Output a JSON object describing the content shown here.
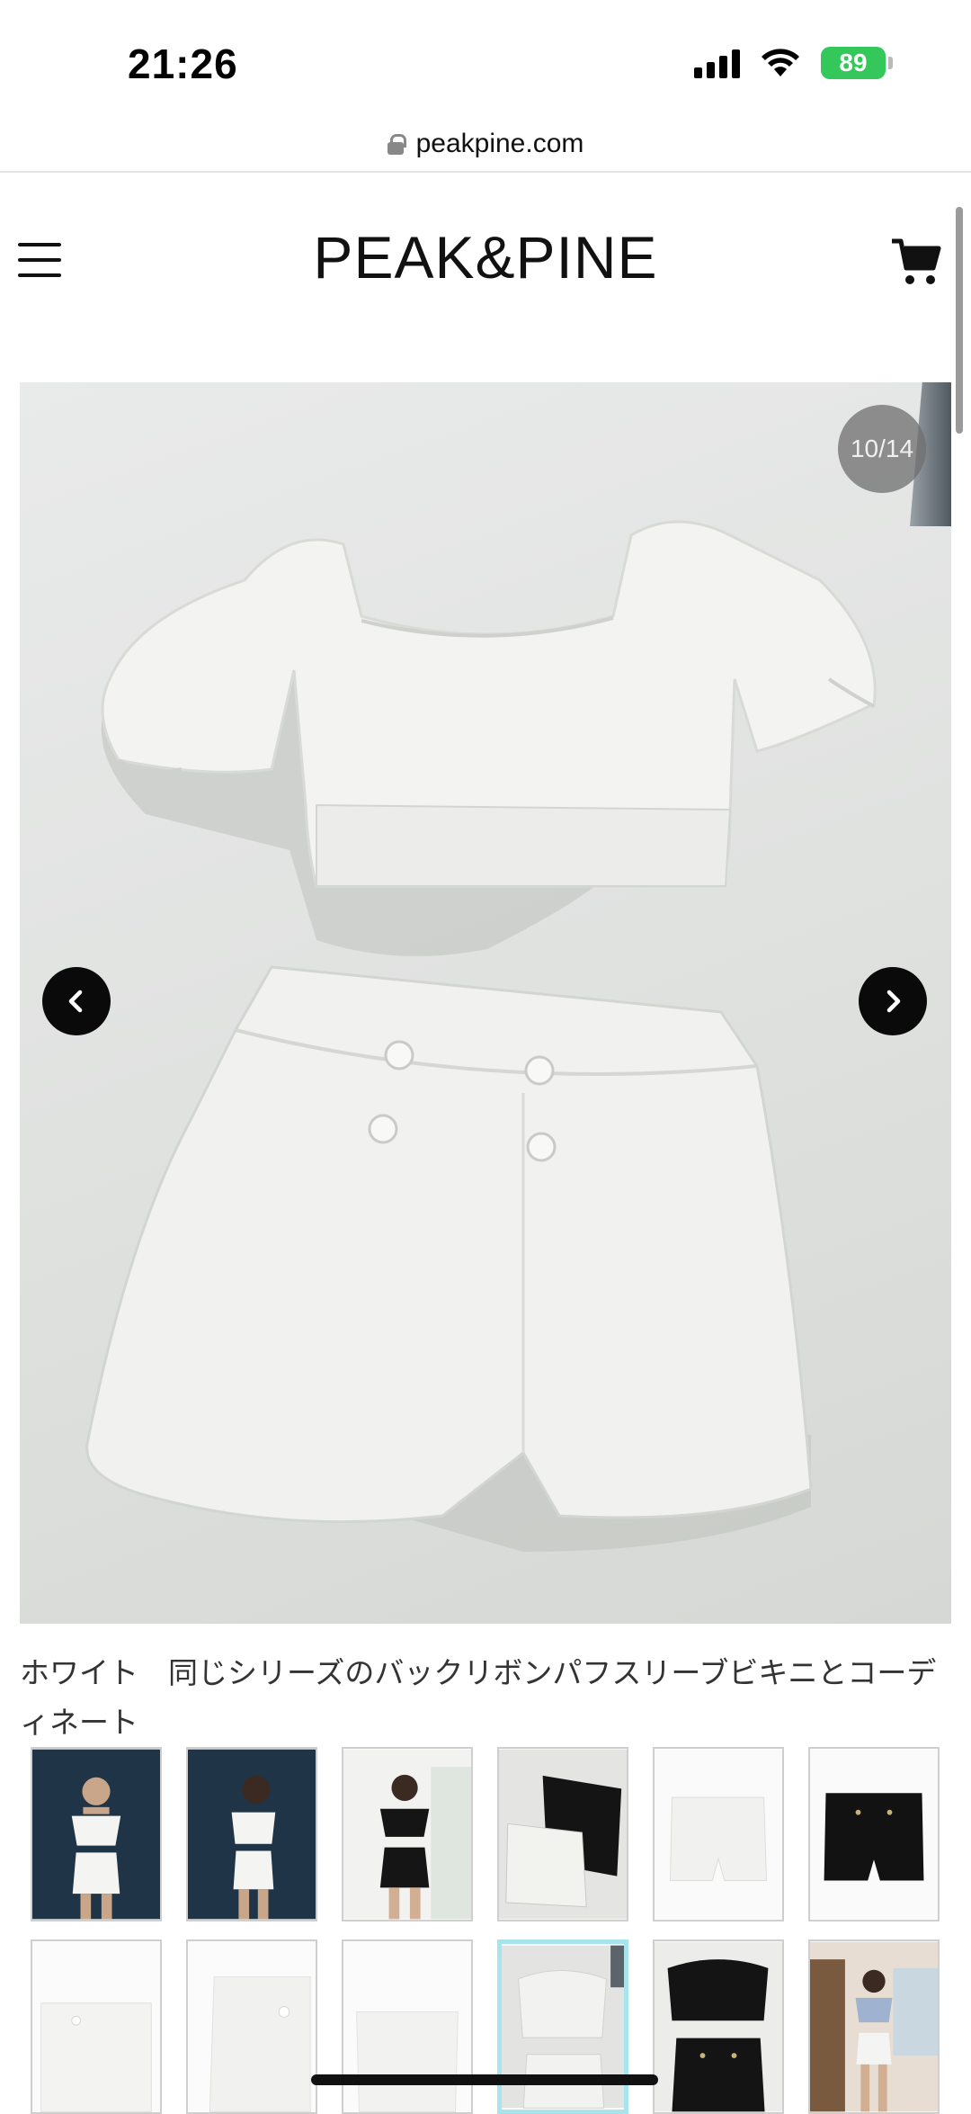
{
  "status_bar": {
    "time": "21:26",
    "battery": "89",
    "icons": [
      "cellular-signal-icon",
      "wifi-icon",
      "battery-charging-icon"
    ]
  },
  "browser": {
    "url": "peakpine.com"
  },
  "header": {
    "logo": "PEAK&PINE",
    "icons": [
      "hamburger-menu-icon",
      "cart-icon"
    ]
  },
  "gallery": {
    "counter": "10/14",
    "icons": [
      "chevron-left-icon",
      "chevron-right-icon"
    ]
  },
  "product": {
    "caption": "ホワイト　同じシリーズのバックリボンパフスリーブビキニとコーディネート"
  },
  "thumbnails": {
    "total": 12,
    "selected_index": 9
  },
  "colors": {
    "accent_selected_border": "#a7e4ec",
    "battery_green": "#34c759",
    "arrow_bg": "#0a0a0a"
  }
}
